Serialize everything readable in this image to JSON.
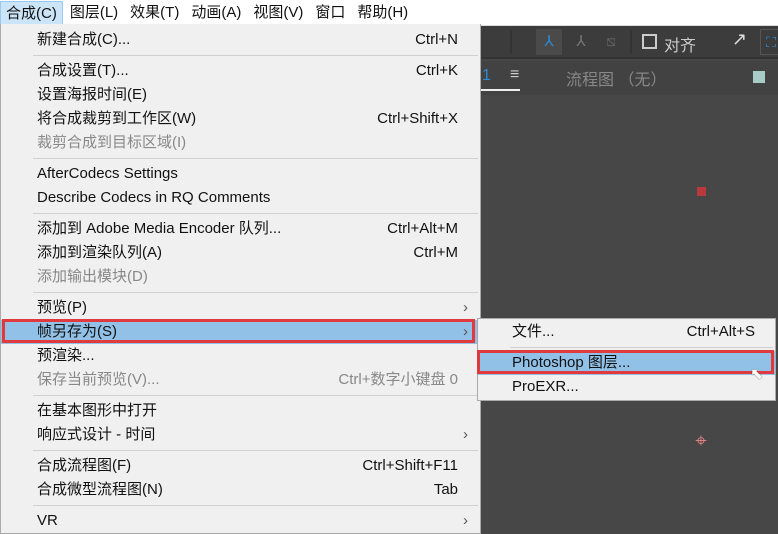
{
  "menubar": [
    "合成(C)",
    "图层(L)",
    "效果(T)",
    "动画(A)",
    "视图(V)",
    "窗口",
    "帮助(H)"
  ],
  "toolbar": {
    "align_label": "对齐"
  },
  "panel": {
    "tab_suffix": "1",
    "flow_label": "流程图 （无）"
  },
  "menu": [
    {
      "label": "新建合成(C)...",
      "shortcut": "Ctrl+N"
    },
    {
      "sep": true
    },
    {
      "label": "合成设置(T)...",
      "shortcut": "Ctrl+K"
    },
    {
      "label": "设置海报时间(E)"
    },
    {
      "label": "将合成裁剪到工作区(W)",
      "shortcut": "Ctrl+Shift+X"
    },
    {
      "label": "裁剪合成到目标区域(I)",
      "disabled": true
    },
    {
      "sep": true
    },
    {
      "label": "AfterCodecs Settings"
    },
    {
      "label": "Describe Codecs in RQ Comments"
    },
    {
      "sep": true
    },
    {
      "label": "添加到 Adobe Media Encoder 队列...",
      "shortcut": "Ctrl+Alt+M"
    },
    {
      "label": "添加到渲染队列(A)",
      "shortcut": "Ctrl+M"
    },
    {
      "label": "添加输出模块(D)",
      "disabled": true
    },
    {
      "sep": true
    },
    {
      "label": "预览(P)",
      "submenu": true
    },
    {
      "label": "帧另存为(S)",
      "submenu": true,
      "highlighted": true
    },
    {
      "label": "预渲染..."
    },
    {
      "label": "保存当前预览(V)...",
      "shortcut": "Ctrl+数字小键盘 0",
      "disabled": true
    },
    {
      "sep": true
    },
    {
      "label": "在基本图形中打开"
    },
    {
      "label": "响应式设计 - 时间",
      "submenu": true
    },
    {
      "sep": true
    },
    {
      "label": "合成流程图(F)",
      "shortcut": "Ctrl+Shift+F11"
    },
    {
      "label": "合成微型流程图(N)",
      "shortcut": "Tab"
    },
    {
      "sep": true
    },
    {
      "label": "VR",
      "submenu": true
    }
  ],
  "submenu": [
    {
      "label": "文件...",
      "shortcut": "Ctrl+Alt+S"
    },
    {
      "sep": true
    },
    {
      "label": "Photoshop 图层...",
      "highlighted": true
    },
    {
      "label": "ProEXR..."
    }
  ],
  "arrow_glyph": "›"
}
